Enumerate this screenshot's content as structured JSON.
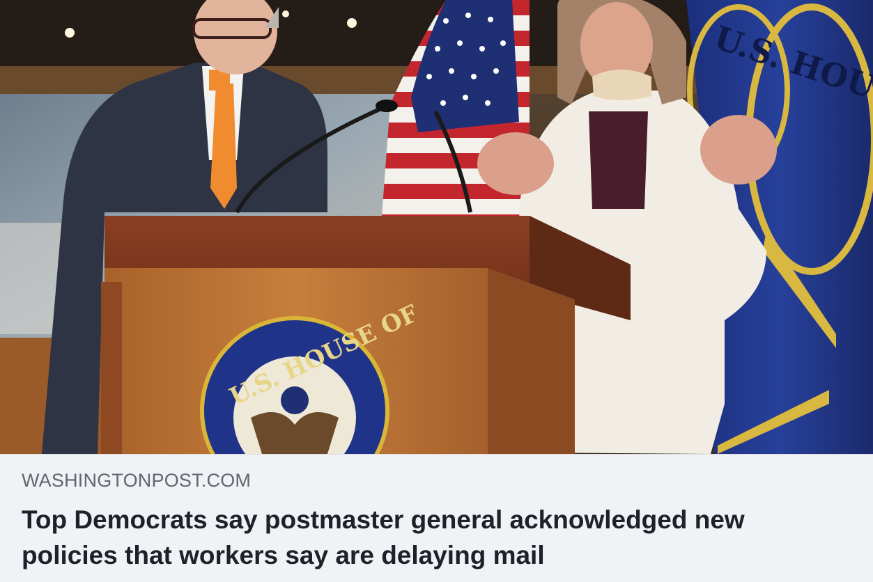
{
  "link_preview": {
    "domain": "WASHINGTONPOST.COM",
    "headline": "Top Democrats say postmaster general acknowledged new policies that workers say are delaying mail"
  },
  "photo": {
    "seal_text": "U.S. HOUSE OF",
    "flag_text": "U.S. HOUSE OF REPRESENTATIVES"
  }
}
